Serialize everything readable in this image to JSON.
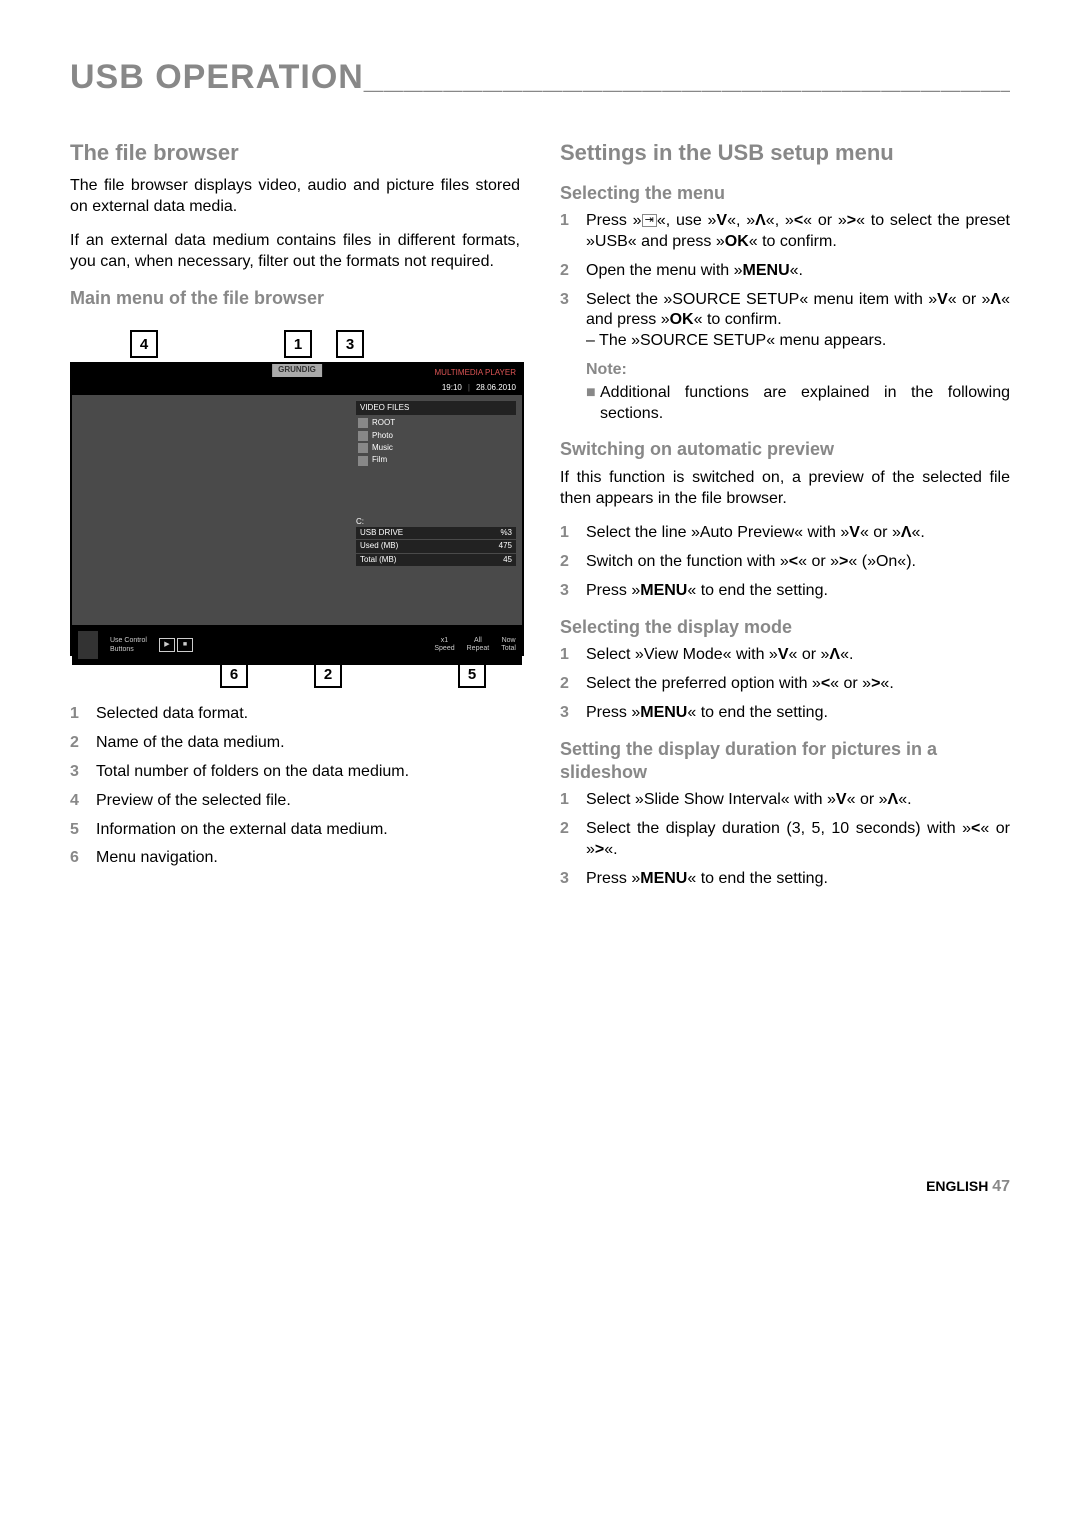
{
  "page_title": "USB OPERATION___________________________________",
  "left": {
    "h_file_browser": "The file browser",
    "p_fb_1": "The file browser displays video, audio and picture files stored on external data media.",
    "p_fb_2": "If an external data medium contains files in different formats, you can, when necessary, filter out the formats not required.",
    "h_main_menu": "Main menu of the file browser",
    "callouts_top": [
      "4",
      "1",
      "3"
    ],
    "callouts_bottom": [
      "6",
      "2",
      "5"
    ],
    "legend": [
      {
        "n": "1",
        "t": "Selected data format."
      },
      {
        "n": "2",
        "t": "Name of the data medium."
      },
      {
        "n": "3",
        "t": "Total number of folders on the data medium."
      },
      {
        "n": "4",
        "t": "Preview of the selected file."
      },
      {
        "n": "5",
        "t": "Information on the external data medium."
      },
      {
        "n": "6",
        "t": "Menu navigation."
      }
    ]
  },
  "tv": {
    "brand": "GRUNDIG",
    "mode": "MULTIMEDIA PLAYER",
    "time": "19:10",
    "date": "28.06.2010",
    "panel_header": "VIDEO FILES",
    "rows": [
      "ROOT",
      "Photo",
      "Music",
      "Film"
    ],
    "drive_label": "C:",
    "drive_name": "USB DRIVE",
    "drive_pct": "%3",
    "used_label": "Used (MB)",
    "used_val": "475",
    "total_label": "Total (MB)",
    "total_val": "45",
    "bottom_hint": "Use Control\nButtons",
    "bot_cols": [
      {
        "a": "x1",
        "b": "Speed"
      },
      {
        "a": "All",
        "b": "Repeat"
      },
      {
        "a": "Now",
        "b": "Total"
      }
    ]
  },
  "right": {
    "h_settings": "Settings in the USB setup menu",
    "h_selecting_menu": "Selecting the menu",
    "sel_menu_steps": [
      "Press »   «, use »V«, »Λ«, »<« or »>« to select the preset »USB« and press »OK« to confirm.",
      "Open the menu with »MENU«.",
      "Select the »SOURCE SETUP« menu item with »V« or »Λ« and press »OK« to confirm."
    ],
    "sel_menu_sub": "– The »SOURCE SETUP« menu appears.",
    "note_label": "Note:",
    "note_text": "Additional functions are explained in the following sections.",
    "h_auto_preview": "Switching on automatic preview",
    "p_auto_preview": "If this function is switched on, a preview of the selected file then appears in the file browser.",
    "auto_steps": [
      "Select the line »Auto Preview« with »V« or »Λ«.",
      "Switch on the function with »<« or »>« (»On«).",
      "Press »MENU« to end the setting."
    ],
    "h_disp_mode": "Selecting the display mode",
    "disp_steps": [
      "Select »View Mode« with »V« or »Λ«.",
      "Select the preferred option with »<« or »>«.",
      "Press »MENU« to end the setting."
    ],
    "h_slide": "Setting the display duration for pictures in a slideshow",
    "slide_steps": [
      "Select »Slide Show Interval« with »V« or »Λ«.",
      "Select the display duration (3, 5, 10 seconds) with »<« or »>«.",
      "Press »MENU« to end the setting."
    ]
  },
  "footer": {
    "lang": "ENGLISH",
    "page": "47"
  }
}
